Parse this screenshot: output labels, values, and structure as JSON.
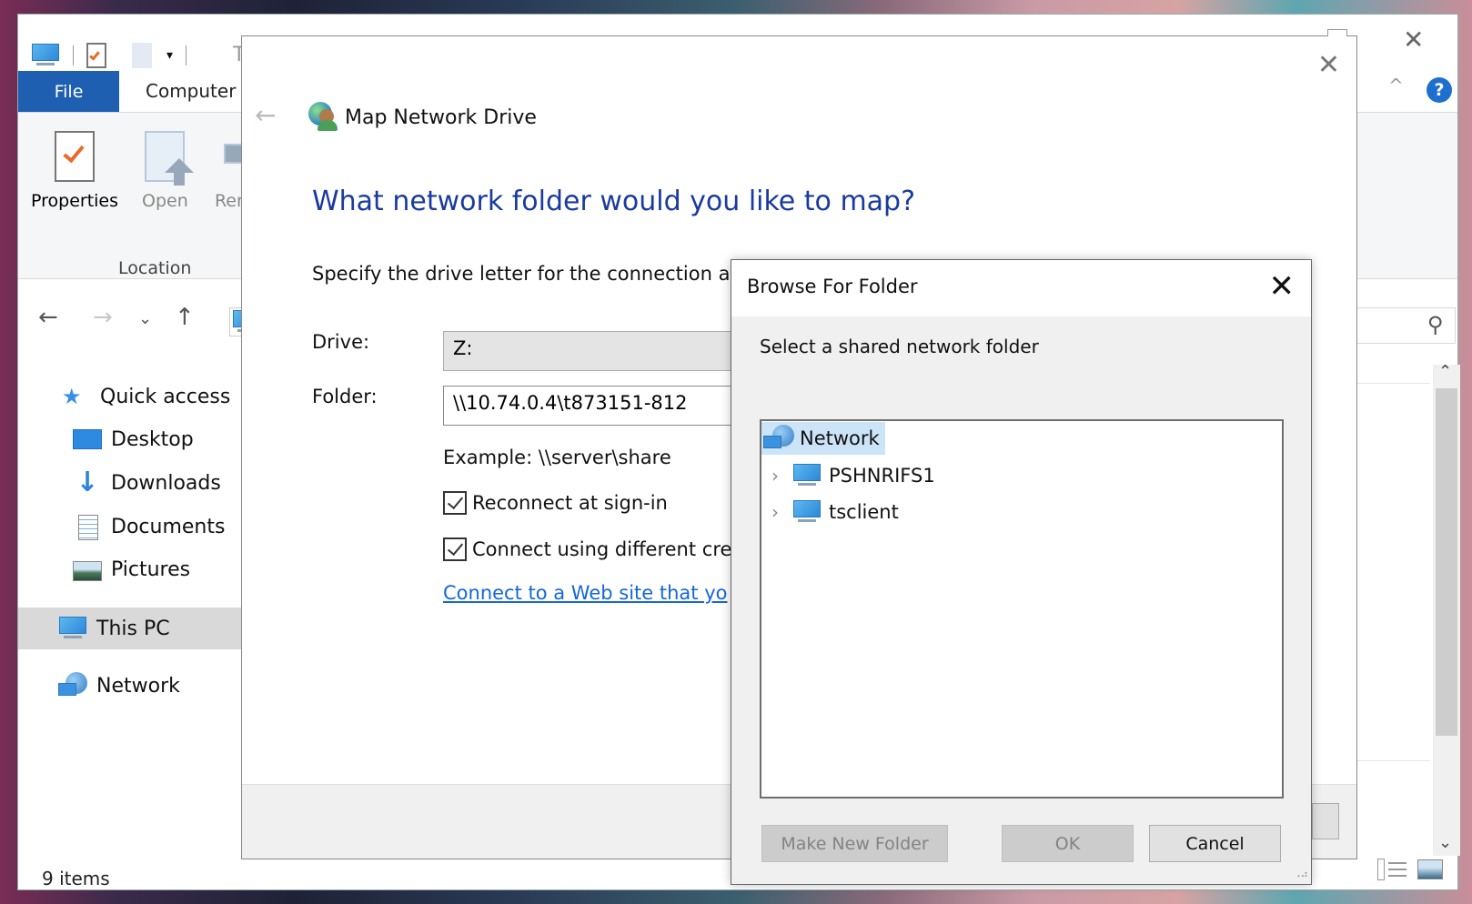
{
  "explorer": {
    "title_partial": "Th",
    "close_glyph": "✕",
    "ribbon_tabs": {
      "file": "File",
      "computer": "Computer"
    },
    "help_glyph": "?",
    "collapse_glyph": "^",
    "ribbon_buttons": [
      {
        "label": "Properties",
        "icon": "properties-icon",
        "enabled": true
      },
      {
        "label": "Open",
        "icon": "open-icon",
        "enabled": false
      },
      {
        "label": "Ren",
        "icon": "rename-icon",
        "enabled": false
      }
    ],
    "ribbon_group": "Location",
    "nav_glyphs": {
      "back": "←",
      "forward": "→",
      "recent": "⌄",
      "up": "↑",
      "search": "⚲"
    },
    "nav_pane": [
      {
        "label": "Quick access",
        "icon": "quick-access-star-icon"
      },
      {
        "label": "Desktop",
        "icon": "desktop-icon"
      },
      {
        "label": "Downloads",
        "icon": "downloads-icon"
      },
      {
        "label": "Documents",
        "icon": "documents-icon"
      },
      {
        "label": "Pictures",
        "icon": "pictures-icon"
      },
      {
        "label": "This PC",
        "icon": "this-pc-icon",
        "selected": true
      },
      {
        "label": "Network",
        "icon": "network-icon"
      }
    ],
    "status": "9 items",
    "accent_color": "#1f5fb1"
  },
  "map_network_drive": {
    "title": "Map Network Drive",
    "back_glyph": "←",
    "close_glyph": "✕",
    "heading": "What network folder would you like to map?",
    "instruction": "Specify the drive letter for the connection ar",
    "drive_label": "Drive:",
    "drive_value": "Z:",
    "folder_label": "Folder:",
    "folder_value": "\\\\10.74.0.4\\t873151-812",
    "example": "Example: \\\\server\\share",
    "reconnect_label": "Reconnect at sign-in",
    "reconnect_checked": true,
    "diff_creds_label": "Connect using different cre",
    "diff_creds_checked": true,
    "link": "Connect to a Web site that yo",
    "heading_color": "#1a3aa0",
    "link_color": "#1566d8"
  },
  "browse_for_folder": {
    "title": "Browse For Folder",
    "close_glyph": "✕",
    "description": "Select a shared network folder",
    "tree": [
      {
        "label": "Network",
        "level": 0,
        "selected": true,
        "expandable": false
      },
      {
        "label": "PSHNRIFS1",
        "level": 1,
        "selected": false,
        "expandable": true
      },
      {
        "label": "tsclient",
        "level": 1,
        "selected": false,
        "expandable": true
      }
    ],
    "chevron_glyph": "›",
    "buttons": {
      "make_new_folder": "Make New Folder",
      "ok": "OK",
      "cancel": "Cancel"
    },
    "selection_color": "#cce4f7"
  }
}
